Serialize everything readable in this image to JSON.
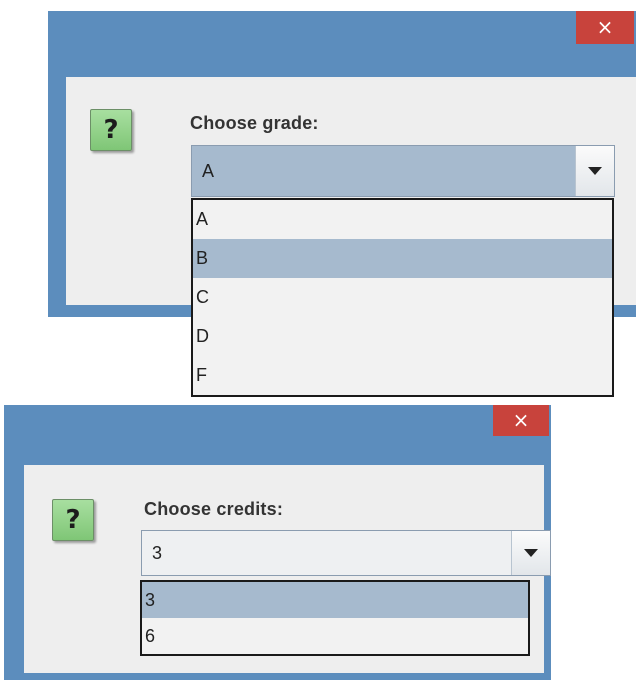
{
  "dialog_grade": {
    "close_label": "×",
    "icon_glyph": "?",
    "prompt": "Choose grade:",
    "selected_value": "A",
    "options": [
      "A",
      "B",
      "C",
      "D",
      "F"
    ],
    "highlighted_option": "B"
  },
  "dialog_credits": {
    "close_label": "×",
    "icon_glyph": "?",
    "prompt": "Choose credits:",
    "selected_value": "3",
    "options": [
      "3",
      "6"
    ],
    "highlighted_option": "3"
  },
  "colors": {
    "titlebar": "#5c8dbd",
    "close_button": "#c8433c",
    "selection": "#a6bace",
    "icon_green": "#8fd487"
  }
}
